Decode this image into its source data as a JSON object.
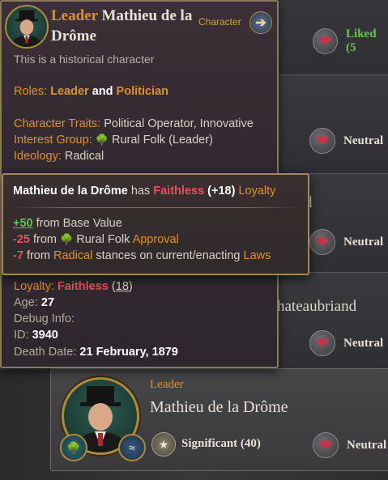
{
  "tooltip": {
    "role": "Leader",
    "name": "Mathieu de la Drôme",
    "type_label": "Character",
    "arrow_icon": "arrow-right-icon",
    "historical": "This is a historical character",
    "roles_label": "Roles:",
    "roles": [
      "Leader",
      "Politician"
    ],
    "roles_join": "and",
    "traits_label": "Character Traits:",
    "traits": "Political Operator, Innovative",
    "ig_label": "Interest Group:",
    "ig_name": "Rural Folk",
    "ig_suffix": "(Leader)",
    "ideology_label": "Ideology:",
    "ideology": "Radical",
    "loyalty_label": "Loyalty:",
    "loyalty_status": "Faithless",
    "loyalty_value": "18",
    "age_label": "Age:",
    "age": "27",
    "debug_label": "Debug Info:",
    "id_label": "ID:",
    "id": "3940",
    "death_label": "Death Date:",
    "death_date": "21 February, 1879"
  },
  "loyalty_tooltip": {
    "name": "Mathieu de la Drôme",
    "has": "has",
    "status": "Faithless",
    "delta": "(+18)",
    "loyalty_word": "Loyalty",
    "lines": [
      {
        "value": "+50",
        "text": "from Base Value"
      },
      {
        "value": "-25",
        "text": "from",
        "ig": "Rural Folk",
        "tail": "Approval"
      },
      {
        "value": "-7",
        "text": "from",
        "ideology": "Radical",
        "mid": "stances on current/enacting",
        "laws": "Laws"
      }
    ]
  },
  "background": {
    "relations": [
      "Liked (5",
      "Neutral",
      "Neutral",
      "Neutral",
      "Neutral"
    ],
    "partial_names": [
      "d",
      "hateaubriand"
    ],
    "card": {
      "role": "Leader",
      "name": "Mathieu de la Drôme",
      "clout": "Significant (40)"
    }
  },
  "colors": {
    "accent_orange": "#e0902c",
    "faithless_red": "#e05560",
    "positive_green": "#5ec25e",
    "liked_green": "#6fbf5a",
    "border_gold": "#8a7a58"
  }
}
